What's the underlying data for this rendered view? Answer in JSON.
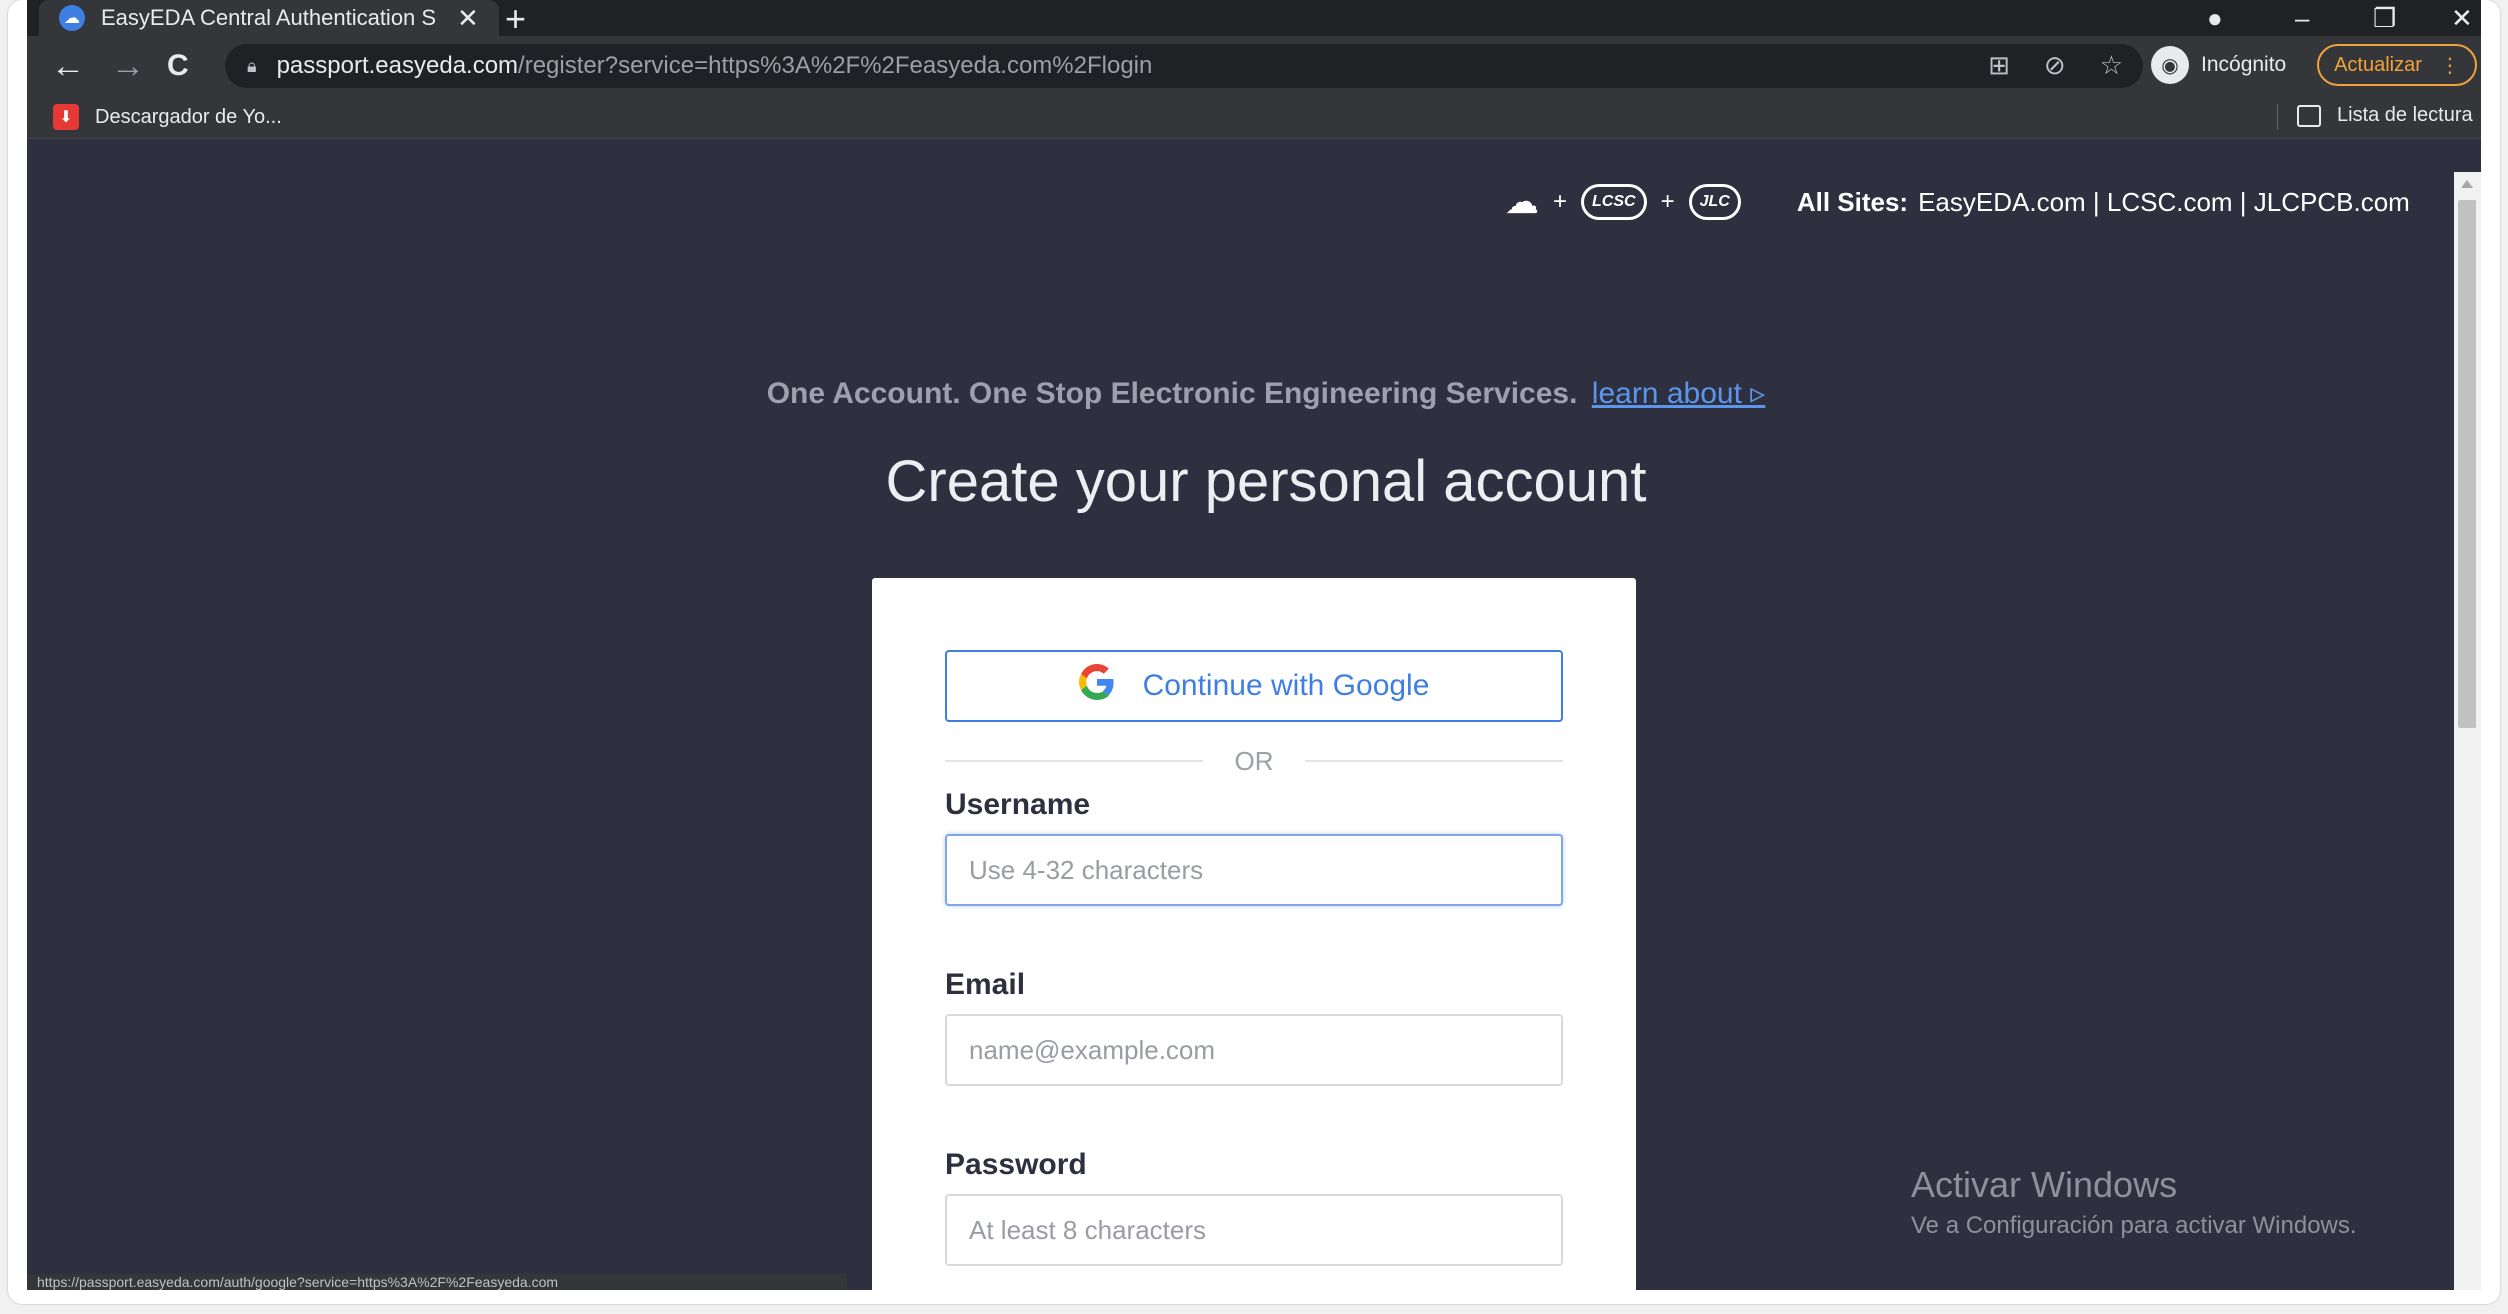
{
  "tab": {
    "title": "EasyEDA Central Authentication S",
    "favicon": "easyeda-cloud",
    "close": "✕",
    "new_tab": "+"
  },
  "window_controls": {
    "profile": "●",
    "minimize": "–",
    "restore": "❐",
    "close": "✕"
  },
  "toolbar": {
    "back": "←",
    "forward": "→",
    "reload": "C",
    "url_host": "passport.easyeda.com",
    "url_path": "/register?service=https%3A%2F%2Feasyeda.com%2Flogin",
    "incognito_label": "Incógnito",
    "update_label": "Actualizar"
  },
  "bookmarks": {
    "item_label": "Descargador de Yo...",
    "reading_list_label": "Lista de lectura"
  },
  "page": {
    "sites_label": "All Sites:",
    "sites_list": "EasyEDA.com | LCSC.com | JLCPCB.com",
    "logo_lcsc": "LCSC",
    "logo_jlc": "JLC",
    "tagline": "One Account. One Stop Electronic Engineering Services.",
    "learn_link": "learn about ▹",
    "title": "Create your personal account",
    "google_button": "Continue with Google",
    "or_text": "OR",
    "username_label": "Username",
    "username_placeholder": "Use 4-32 characters",
    "email_label": "Email",
    "email_placeholder": "name@example.com",
    "password_label": "Password",
    "password_placeholder": "At least 8 characters"
  },
  "watermark": {
    "title": "Activar Windows",
    "subtitle": "Ve a Configuración para activar Windows."
  },
  "status_bar": {
    "text": "https://passport.easyeda.com/auth/google?service=https%3A%2F%2Feasyeda.com"
  },
  "colors": {
    "page_bg": "#2e303f",
    "accent_blue": "#3f7fe3",
    "update_orange": "#f0a33a"
  }
}
